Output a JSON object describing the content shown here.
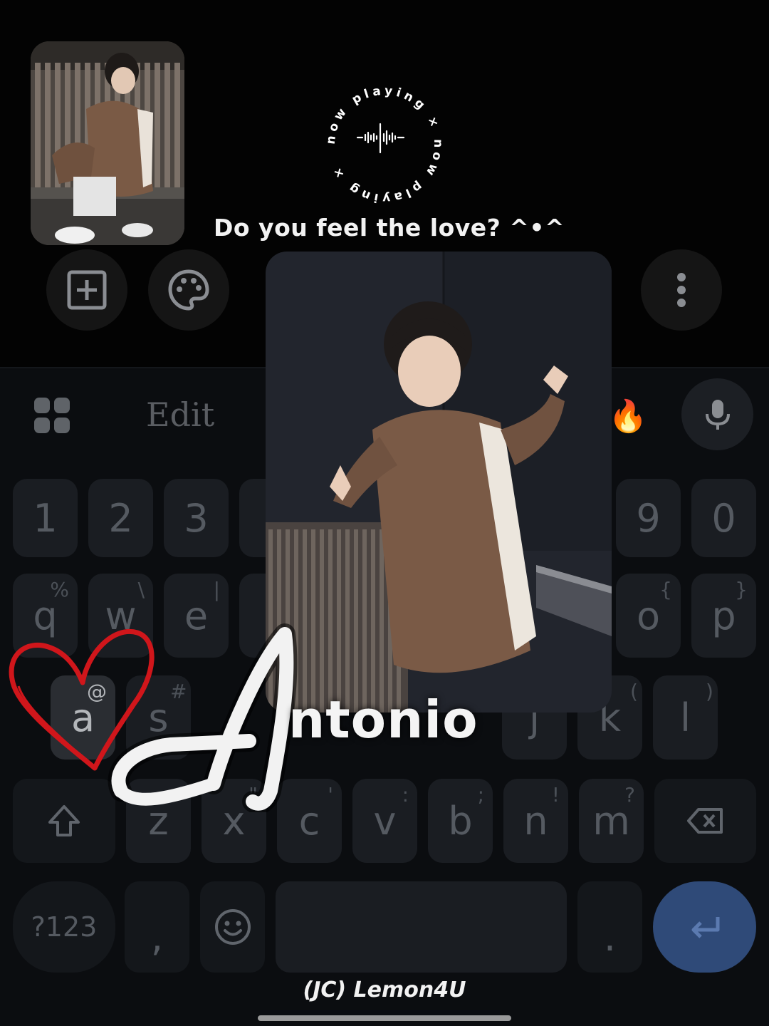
{
  "header": {
    "badge_text": "now playing × now playing ×",
    "tagline": "Do you feel the love? ^•^"
  },
  "toolbar": {
    "icons": [
      "add-box-icon",
      "palette-icon",
      "more-vert-icon"
    ]
  },
  "suggestion_bar": {
    "edit_label": "Edit",
    "emoji": "🔥"
  },
  "keyboard": {
    "number_row": [
      {
        "label": "1"
      },
      {
        "label": "2"
      },
      {
        "label": "3"
      },
      {
        "label": "9"
      },
      {
        "label": "0"
      }
    ],
    "top_row": [
      {
        "label": "q",
        "sub": "%"
      },
      {
        "label": "w",
        "sub": "\\"
      },
      {
        "label": "e",
        "sub": "|"
      },
      {
        "label": "o",
        "sub": "{"
      },
      {
        "label": "p",
        "sub": "}"
      }
    ],
    "home_row": [
      {
        "label": "a",
        "sub": "@"
      },
      {
        "label": "s",
        "sub": "#"
      },
      {
        "label": "j",
        "sub": ""
      },
      {
        "label": "k",
        "sub": "("
      },
      {
        "label": "l",
        "sub": ")"
      }
    ],
    "bottom_row": [
      {
        "label": "z",
        "sub": "*"
      },
      {
        "label": "x",
        "sub": "\""
      },
      {
        "label": "c",
        "sub": "'"
      },
      {
        "label": "v",
        "sub": ":"
      },
      {
        "label": "b",
        "sub": ";"
      },
      {
        "label": "n",
        "sub": "!"
      },
      {
        "label": "m",
        "sub": "?"
      }
    ],
    "symbols_label": "?123",
    "comma_label": ",",
    "period_label": "."
  },
  "overlay": {
    "name_initial": "A",
    "name_rest": "ntonio",
    "credit": "(JC) Lemon4U"
  },
  "colors": {
    "heart": "#d0161b",
    "enter_key": "#2f4a78"
  }
}
